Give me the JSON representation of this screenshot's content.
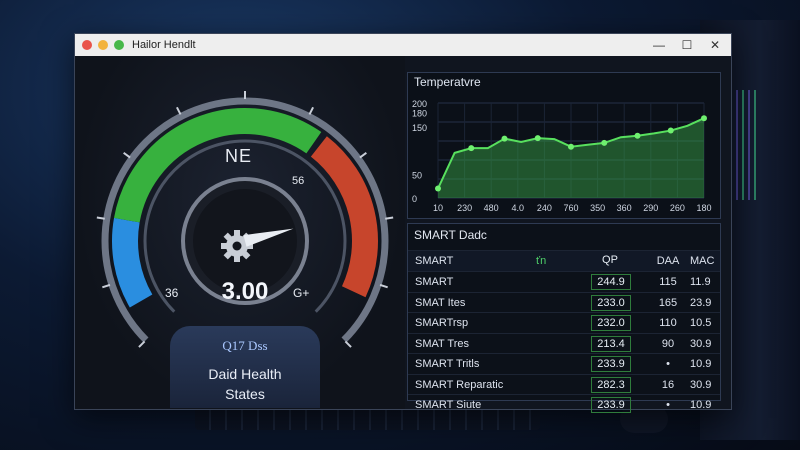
{
  "window": {
    "title": "Hailor Hendlt",
    "controls": [
      "—",
      "☐",
      "✕"
    ],
    "dot_colors": [
      "#e9534a",
      "#f2b33c",
      "#47b84a"
    ]
  },
  "gauge": {
    "top_label": "NE",
    "right_label": "56",
    "left_label": "36",
    "value": "3.00",
    "value_right": "G+",
    "sub_label": "Q17 Dss",
    "health_label": "Daid Health",
    "health_sub": "States",
    "level": 0.78,
    "icon": "gear-icon",
    "colors": {
      "blue": "#2a8ee0",
      "green": "#37b13e",
      "red": "#c7452c"
    }
  },
  "temperature": {
    "title": "Temperatvre",
    "y_ticks": [
      "200",
      "180",
      "150",
      "50",
      "0"
    ],
    "x_ticks": [
      "10",
      "230",
      "480",
      "4.0",
      "240",
      "760",
      "350",
      "360",
      "290",
      "260",
      "180"
    ],
    "values": [
      20,
      95,
      105,
      105,
      125,
      118,
      126,
      124,
      108,
      112,
      116,
      128,
      131,
      136,
      142,
      152,
      168
    ]
  },
  "smart": {
    "title": "SMART Dadc",
    "headers": [
      "SMART",
      "ťn",
      "QP",
      "DAA",
      "MAC"
    ],
    "rows": [
      {
        "name": "SMART",
        "value": "244.9",
        "a": "115",
        "b": "11.9"
      },
      {
        "name": "SMAT Ites",
        "value": "233.0",
        "a": "165",
        "b": "23.9"
      },
      {
        "name": "SMARTrsp",
        "value": "232.0",
        "a": "110",
        "b": "10.5"
      },
      {
        "name": "SMAT Tres",
        "value": "213.4",
        "a": "90",
        "b": "30.9"
      },
      {
        "name": "SMART Tritls",
        "value": "233.9",
        "a": "•",
        "b": "10.9"
      },
      {
        "name": "SMART Reparatic",
        "value": "282.3",
        "a": "16",
        "b": "30.9"
      },
      {
        "name": "SMART Siute",
        "value": "233.9",
        "a": "•",
        "b": "10.9"
      }
    ]
  }
}
